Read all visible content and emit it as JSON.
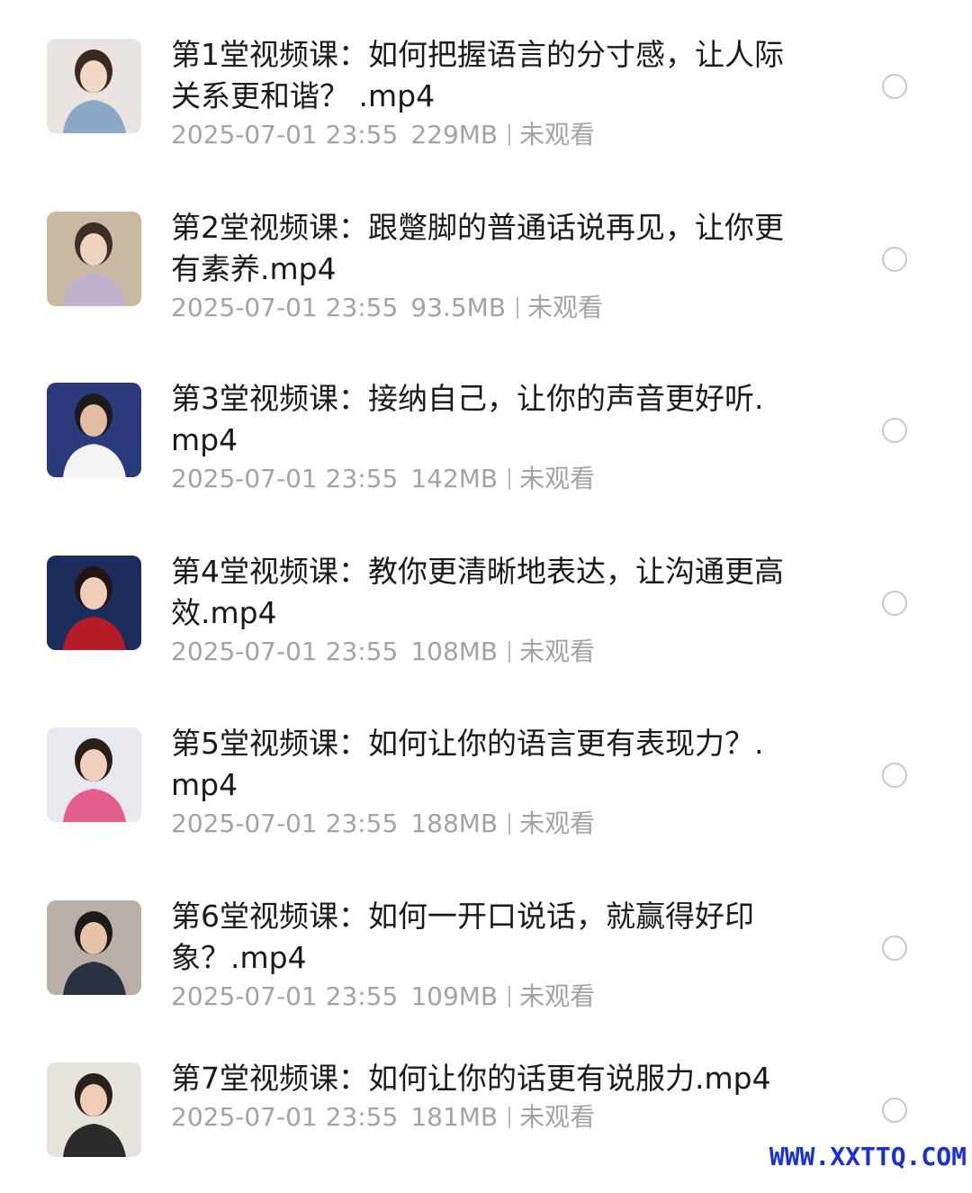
{
  "files": [
    {
      "title": "第1堂视频课：如何把握语言的分寸感，让人际关系更和谐？ .mp4",
      "date": "2025-07-01 23:55",
      "size": "229MB",
      "status": "未观看",
      "thumb_colors": [
        "#e9e4e0",
        "#3a2a22",
        "#f2d6c6",
        "#8aa7c4"
      ]
    },
    {
      "title": "第2堂视频课：跟蹩脚的普通话说再见，让你更有素养.mp4",
      "date": "2025-07-01 23:55",
      "size": "93.5MB",
      "status": "未观看",
      "thumb_colors": [
        "#c9b9a3",
        "#3b2f28",
        "#efd3c1",
        "#bfb1cf"
      ]
    },
    {
      "title": "第3堂视频课：接纳自己，让你的声音更好听.mp4",
      "date": "2025-07-01 23:55",
      "size": "142MB",
      "status": "未观看",
      "thumb_colors": [
        "#2a3a7a",
        "#1b1b1b",
        "#e2bca3",
        "#f4f4f4"
      ]
    },
    {
      "title": "第4堂视频课：教你更清晰地表达，让沟通更高效.mp4",
      "date": "2025-07-01 23:55",
      "size": "108MB",
      "status": "未观看",
      "thumb_colors": [
        "#1c2d5c",
        "#231515",
        "#f0cdb7",
        "#b51c26"
      ]
    },
    {
      "title": "第5堂视频课：如何让你的语言更有表现力？.mp4",
      "date": "2025-07-01 23:55",
      "size": "188MB",
      "status": "未观看",
      "thumb_colors": [
        "#e7e9ee",
        "#2a1e1a",
        "#f2d0bf",
        "#e35d8d"
      ]
    },
    {
      "title": "第6堂视频课：如何一开口说话，就赢得好印象？.mp4",
      "date": "2025-07-01 23:55",
      "size": "109MB",
      "status": "未观看",
      "thumb_colors": [
        "#b8b0a8",
        "#1b1b1b",
        "#e7c3a8",
        "#2a3242"
      ]
    },
    {
      "title": "第7堂视频课：如何让你的话更有说服力.mp4",
      "date": "2025-07-01 23:55",
      "size": "181MB",
      "status": "未观看",
      "thumb_colors": [
        "#e6e2dc",
        "#2a1f1a",
        "#f0cdb8",
        "#2b2b2b"
      ]
    }
  ],
  "watermark": "WWW.XXTTQ.COM"
}
